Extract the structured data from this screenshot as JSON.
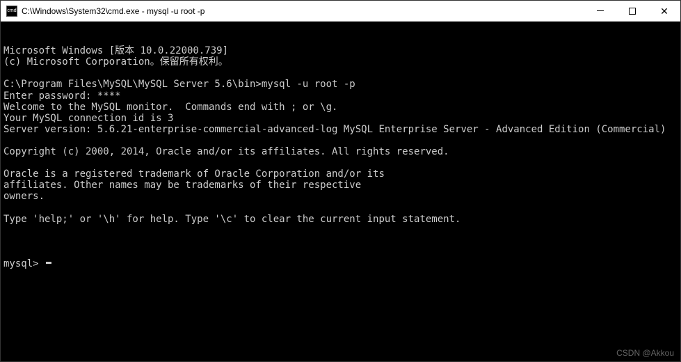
{
  "titlebar": {
    "icon_label": "cmd",
    "title": "C:\\Windows\\System32\\cmd.exe - mysql  -u root -p"
  },
  "terminal": {
    "lines": [
      "Microsoft Windows [版本 10.0.22000.739]",
      "(c) Microsoft Corporation。保留所有权利。",
      "",
      "C:\\Program Files\\MySQL\\MySQL Server 5.6\\bin>mysql -u root -p",
      "Enter password: ****",
      "Welcome to the MySQL monitor.  Commands end with ; or \\g.",
      "Your MySQL connection id is 3",
      "Server version: 5.6.21-enterprise-commercial-advanced-log MySQL Enterprise Server - Advanced Edition (Commercial)",
      "",
      "Copyright (c) 2000, 2014, Oracle and/or its affiliates. All rights reserved.",
      "",
      "Oracle is a registered trademark of Oracle Corporation and/or its",
      "affiliates. Other names may be trademarks of their respective",
      "owners.",
      "",
      "Type 'help;' or '\\h' for help. Type '\\c' to clear the current input statement.",
      ""
    ],
    "prompt": "mysql> "
  },
  "watermark": "CSDN @Akkou"
}
